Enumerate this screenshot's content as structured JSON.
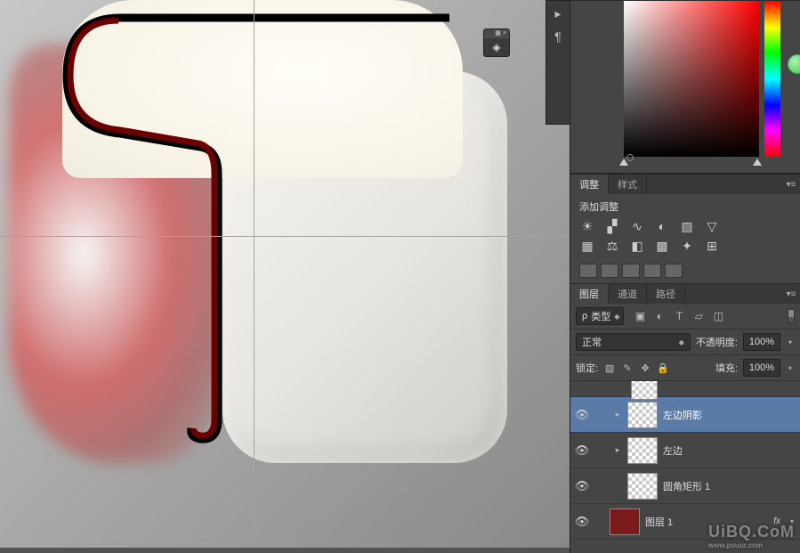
{
  "float_widget": {
    "icon": "3d-icon"
  },
  "adjustments": {
    "tab_adjust": "调整",
    "tab_style": "样式",
    "title": "添加调整",
    "row1_icons": [
      "brightness-icon",
      "levels-icon",
      "curves-icon",
      "exposure-icon",
      "vibrance-icon",
      "triangle-icon"
    ],
    "row2_icons": [
      "hue-icon",
      "balance-icon",
      "bw-icon",
      "photo-filter-icon",
      "channel-mixer-icon",
      "lookup-icon"
    ],
    "preset_count": 5
  },
  "layers_panel": {
    "tab_layers": "图层",
    "tab_channels": "通道",
    "tab_paths": "路径",
    "kind_label": "类型",
    "filter_icons": [
      "image-filter-icon",
      "adjustment-filter-icon",
      "type-filter-icon",
      "shape-filter-icon",
      "smart-filter-icon"
    ],
    "blend_mode": "正常",
    "opacity_label": "不透明度:",
    "opacity_value": "100%",
    "lock_label": "锁定:",
    "lock_icons": [
      "lock-transparent-icon",
      "lock-brush-icon",
      "lock-position-icon",
      "lock-all-icon"
    ],
    "fill_label": "填充:",
    "fill_value": "100%",
    "layers": [
      {
        "name": "左边阴影",
        "visible": true,
        "selected": true,
        "expandable": true,
        "indent": 1,
        "thumb": "checker"
      },
      {
        "name": "左边",
        "visible": true,
        "selected": false,
        "expandable": true,
        "indent": 1,
        "thumb": "checker"
      },
      {
        "name": "圆角矩形 1",
        "visible": true,
        "selected": false,
        "expandable": false,
        "indent": 1,
        "thumb": "checker"
      },
      {
        "name": "图层 1",
        "visible": true,
        "selected": false,
        "expandable": false,
        "indent": 0,
        "thumb": "solid-red",
        "fx": true
      }
    ],
    "partial_top_thumb": true
  },
  "watermark": {
    "main": "UiBQ.CoM",
    "sub": "www.psuur.com"
  }
}
